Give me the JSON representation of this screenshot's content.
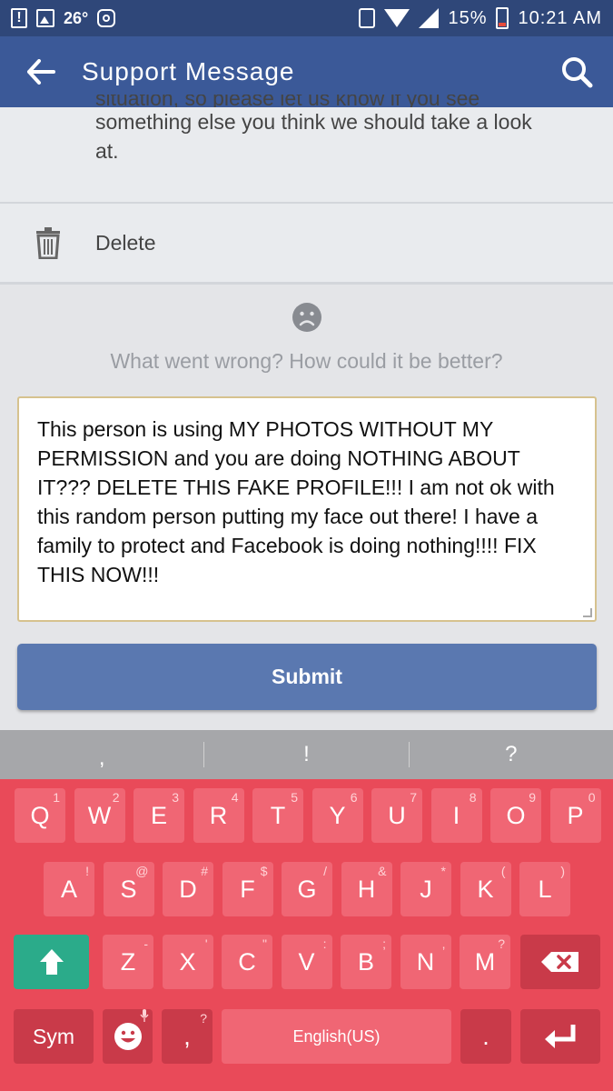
{
  "status_bar": {
    "temperature": "26°",
    "battery": "15%",
    "time": "10:21 AM"
  },
  "app_bar": {
    "title": "Support Message"
  },
  "message": {
    "partial_line": "situation, so please let us know if you see",
    "line2": "something else you think we should take a look",
    "line3": "at."
  },
  "delete": {
    "label": "Delete"
  },
  "feedback": {
    "prompt": "What went wrong? How could it be better?",
    "text": "This person is using MY PHOTOS WITHOUT MY PERMISSION and you are doing NOTHING ABOUT IT??? DELETE THIS FAKE PROFILE!!! I am not ok with this random person putting my face out there! I have a family to protect and Facebook is doing nothing!!!! FIX THIS NOW!!!",
    "submit_label": "Submit"
  },
  "keyboard": {
    "suggestions": [
      ",",
      "!",
      "?"
    ],
    "row1": [
      {
        "label": "Q",
        "hint": "1"
      },
      {
        "label": "W",
        "hint": "2"
      },
      {
        "label": "E",
        "hint": "3"
      },
      {
        "label": "R",
        "hint": "4"
      },
      {
        "label": "T",
        "hint": "5"
      },
      {
        "label": "Y",
        "hint": "6"
      },
      {
        "label": "U",
        "hint": "7"
      },
      {
        "label": "I",
        "hint": "8"
      },
      {
        "label": "O",
        "hint": "9"
      },
      {
        "label": "P",
        "hint": "0"
      }
    ],
    "row2": [
      {
        "label": "A",
        "hint": "!"
      },
      {
        "label": "S",
        "hint": "@"
      },
      {
        "label": "D",
        "hint": "#"
      },
      {
        "label": "F",
        "hint": "$"
      },
      {
        "label": "G",
        "hint": "/"
      },
      {
        "label": "H",
        "hint": "&"
      },
      {
        "label": "J",
        "hint": "*"
      },
      {
        "label": "K",
        "hint": "("
      },
      {
        "label": "L",
        "hint": ")"
      }
    ],
    "row3": [
      {
        "label": "Z",
        "hint": "-"
      },
      {
        "label": "X",
        "hint": "'"
      },
      {
        "label": "C",
        "hint": "\""
      },
      {
        "label": "V",
        "hint": ":"
      },
      {
        "label": "B",
        "hint": ";"
      },
      {
        "label": "N",
        "hint": ","
      },
      {
        "label": "M",
        "hint": "?"
      }
    ],
    "sym_label": "Sym",
    "comma_label": ",",
    "comma_hint": "?",
    "space_label": "English(US)",
    "period_label": ".",
    "colors": {
      "keyboard_bg": "#e94a59",
      "key": "#f06674",
      "key_dark": "#c93a49",
      "shift": "#2bab8a"
    }
  },
  "colors": {
    "facebook_blue": "#3b5998",
    "submit_blue": "#5a78b0"
  }
}
